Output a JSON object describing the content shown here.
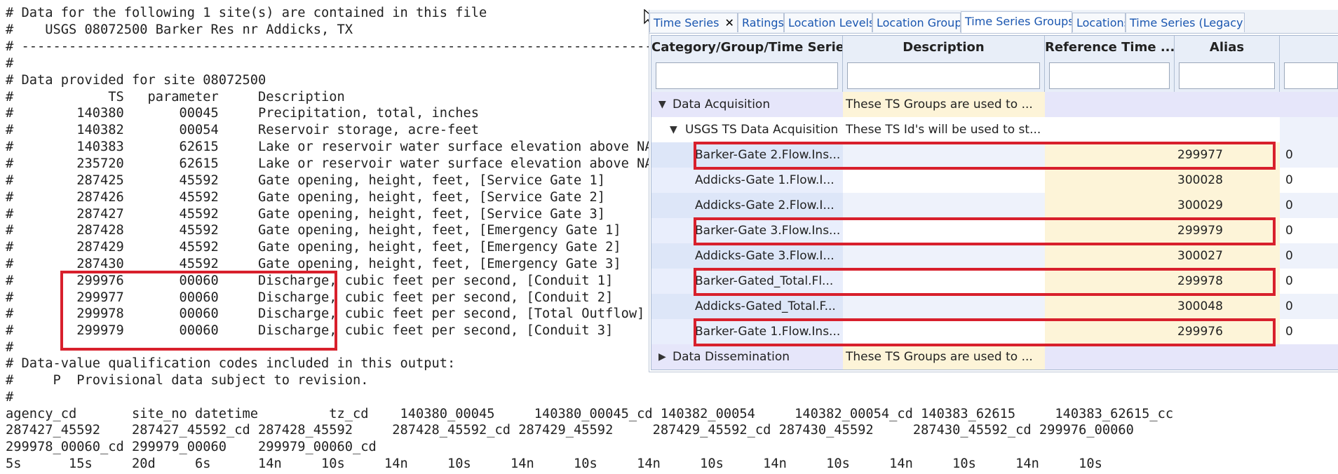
{
  "rdb_lines": [
    "# Data for the following 1 site(s) are contained in this file",
    "#    USGS 08072500 Barker Res nr Addicks, TX",
    "# -----------------------------------------------------------------------------------",
    "#",
    "# Data provided for site 08072500",
    "#            TS   parameter     Description",
    "#        140380       00045     Precipitation, total, inches",
    "#        140382       00054     Reservoir storage, acre-feet",
    "#        140383       62615     Lake or reservoir water surface elevation above NA",
    "#        235720       62615     Lake or reservoir water surface elevation above NA",
    "#        287425       45592     Gate opening, height, feet, [Service Gate 1]",
    "#        287426       45592     Gate opening, height, feet, [Service Gate 2]",
    "#        287427       45592     Gate opening, height, feet, [Service Gate 3]",
    "#        287428       45592     Gate opening, height, feet, [Emergency Gate 1]",
    "#        287429       45592     Gate opening, height, feet, [Emergency Gate 2]",
    "#        287430       45592     Gate opening, height, feet, [Emergency Gate 3]",
    "#        299976       00060     Discharge, cubic feet per second, [Conduit 1]",
    "#        299977       00060     Discharge, cubic feet per second, [Conduit 2]",
    "#        299978       00060     Discharge, cubic feet per second, [Total Outflow]",
    "#        299979       00060     Discharge, cubic feet per second, [Conduit 3]",
    "#",
    "# Data-value qualification codes included in this output:",
    "#     P  Provisional data subject to revision.",
    "#",
    "agency_cd       site_no datetime         tz_cd    140380_00045     140380_00045_cd 140382_00054     140382_00054_cd 140383_62615     140383_62615_cc",
    "287427_45592    287427_45592_cd 287428_45592     287428_45592_cd 287429_45592     287429_45592_cd 287430_45592     287430_45592_cd 299976_00060",
    "299978_00060_cd 299979_00060    299979_00060_cd",
    "5s      15s     20d     6s      14n     10s     14n     10s     14n     10s     14n     10s     14n     10s     14n     10s     14n     10s"
  ],
  "tabs": [
    "Time Series",
    "Ratings",
    "Location Levels",
    "Location Groups",
    "Time Series Groups",
    "Locations",
    "Time Series (Legacy)"
  ],
  "active_tab": "Time Series Groups",
  "grid": {
    "columns": [
      "Category/Group/Time Series",
      "Description",
      "Reference Time ...",
      "Alias",
      ""
    ],
    "rows": [
      {
        "name": "Data Acquisition",
        "desc": "These TS Groups are used to ...",
        "alias": "",
        "extra": ""
      },
      {
        "name": "USGS TS Data Acquisition",
        "desc": "These TS Id's will be used to st...",
        "alias": "",
        "extra": ""
      },
      {
        "name": "Barker-Gate 2.Flow.Ins...",
        "desc": "",
        "alias": "299977",
        "extra": "0"
      },
      {
        "name": "Addicks-Gate 1.Flow.I...",
        "desc": "",
        "alias": "300028",
        "extra": "0"
      },
      {
        "name": "Addicks-Gate 2.Flow.I...",
        "desc": "",
        "alias": "300029",
        "extra": "0"
      },
      {
        "name": "Barker-Gate 3.Flow.Ins...",
        "desc": "",
        "alias": "299979",
        "extra": "0"
      },
      {
        "name": "Addicks-Gate 3.Flow.I...",
        "desc": "",
        "alias": "300027",
        "extra": "0"
      },
      {
        "name": "Barker-Gated_Total.Fl...",
        "desc": "",
        "alias": "299978",
        "extra": "0"
      },
      {
        "name": "Addicks-Gated_Total.F...",
        "desc": "",
        "alias": "300048",
        "extra": "0"
      },
      {
        "name": "Barker-Gate 1.Flow.Ins...",
        "desc": "",
        "alias": "299976",
        "extra": "0"
      },
      {
        "name": "Data Dissemination",
        "desc": "These TS Groups are used to ...",
        "alias": "",
        "extra": ""
      }
    ]
  },
  "colors": {
    "highlight": "#d8202c",
    "category_bg": "#e6e6fa",
    "reftime_bg": "#fdf4d8",
    "row_alt": "#eef2fb"
  }
}
